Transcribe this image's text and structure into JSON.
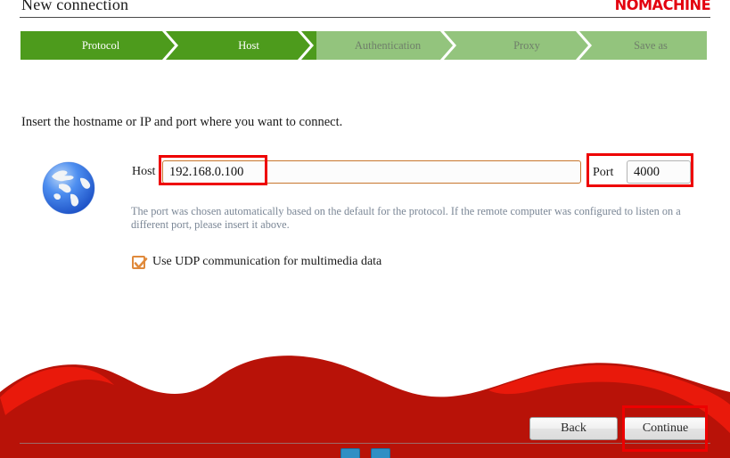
{
  "window": {
    "title": "New connection",
    "brand": "NOMACHINE"
  },
  "stepper": {
    "steps": [
      {
        "label": "Protocol",
        "state": "done"
      },
      {
        "label": "Host",
        "state": "done"
      },
      {
        "label": "Authentication",
        "state": "pending"
      },
      {
        "label": "Proxy",
        "state": "pending"
      },
      {
        "label": "Save as",
        "state": "pending"
      }
    ],
    "colors": {
      "active_bg": "#4d9b1c",
      "active_text": "#ffffff",
      "pending_bg": "#93c47d",
      "pending_text": "#6f7f6a"
    }
  },
  "main": {
    "instruction": "Insert the hostname or IP and port where you want to connect.",
    "globe_icon": "globe-icon",
    "host": {
      "label": "Host",
      "value": "192.168.0.100",
      "placeholder": "",
      "focused": true,
      "border_color": "#c8772e"
    },
    "port": {
      "label": "Port",
      "value": "4000",
      "placeholder": "",
      "focused": false,
      "border_color": "#b3b3b3"
    },
    "helper_text": "The port was chosen automatically based on the default for the protocol. If the remote computer was configured to listen on a different port, please insert it above.",
    "udp_checkbox": {
      "label": "Use UDP communication for multimedia data",
      "checked": true,
      "accent": "#e08a3c"
    }
  },
  "footer": {
    "back_label": "Back",
    "continue_label": "Continue",
    "wave_color_dark": "#b81208",
    "wave_color_bright": "#ee1b0c"
  },
  "annotations": {
    "host_field_highlight": "red-box",
    "port_field_highlight": "red-box",
    "continue_button_highlight": "red-box",
    "color": "#ee0000"
  }
}
